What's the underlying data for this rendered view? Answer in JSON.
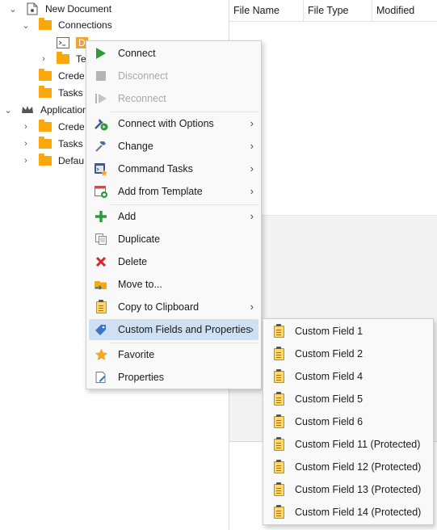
{
  "tree": {
    "items": [
      {
        "label": "New Document",
        "icon": "document-icon"
      },
      {
        "label": "Connections",
        "icon": "folder-icon"
      },
      {
        "label": "D",
        "icon": "terminal-icon"
      },
      {
        "label": "Te",
        "icon": "folder-icon"
      },
      {
        "label": "Crede",
        "icon": "folder-icon"
      },
      {
        "label": "Tasks",
        "icon": "folder-icon"
      },
      {
        "label": "Application",
        "icon": "crown-icon"
      },
      {
        "label": "Crede",
        "icon": "folder-icon"
      },
      {
        "label": "Tasks",
        "icon": "folder-icon"
      },
      {
        "label": "Defau",
        "icon": "folder-icon"
      }
    ]
  },
  "grid": {
    "columns": [
      "File Name",
      "File Type",
      "Modified"
    ]
  },
  "context_menu": {
    "items": [
      {
        "label": "Connect",
        "icon": "play-icon",
        "enabled": true,
        "submenu": false
      },
      {
        "label": "Disconnect",
        "icon": "stop-icon",
        "enabled": false,
        "submenu": false
      },
      {
        "label": "Reconnect",
        "icon": "reconnect-icon",
        "enabled": false,
        "submenu": false
      },
      {
        "label": "Connect with Options",
        "icon": "connect-options-icon",
        "enabled": true,
        "submenu": true
      },
      {
        "label": "Change",
        "icon": "hammer-icon",
        "enabled": true,
        "submenu": true
      },
      {
        "label": "Command Tasks",
        "icon": "command-tasks-icon",
        "enabled": true,
        "submenu": true
      },
      {
        "label": "Add from Template",
        "icon": "template-icon",
        "enabled": true,
        "submenu": true
      },
      {
        "label": "Add",
        "icon": "plus-icon",
        "enabled": true,
        "submenu": true
      },
      {
        "label": "Duplicate",
        "icon": "duplicate-icon",
        "enabled": true,
        "submenu": false
      },
      {
        "label": "Delete",
        "icon": "delete-icon",
        "enabled": true,
        "submenu": false
      },
      {
        "label": "Move to...",
        "icon": "move-folder-icon",
        "enabled": true,
        "submenu": false
      },
      {
        "label": "Copy to Clipboard",
        "icon": "clipboard-icon",
        "enabled": true,
        "submenu": true
      },
      {
        "label": "Custom Fields and Properties",
        "icon": "tag-icon",
        "enabled": true,
        "submenu": true,
        "active": true
      },
      {
        "label": "Favorite",
        "icon": "star-icon",
        "enabled": true,
        "submenu": false
      },
      {
        "label": "Properties",
        "icon": "properties-icon",
        "enabled": true,
        "submenu": false
      }
    ],
    "arrow_glyph": "›"
  },
  "submenu": {
    "items": [
      "Custom Field 1",
      "Custom Field 2",
      "Custom Field 4",
      "Custom Field 5",
      "Custom Field 6",
      "Custom Field 11 (Protected)",
      "Custom Field 12 (Protected)",
      "Custom Field 13 (Protected)",
      "Custom Field 14 (Protected)"
    ],
    "icon": "clipboard-icon"
  },
  "colors": {
    "folder": "#f8a70c",
    "selection": "#f2a230",
    "menu_highlight": "#cfe0f3",
    "connect_green": "#2e9a3a",
    "delete_red": "#d62828",
    "star": "#f5a623"
  }
}
